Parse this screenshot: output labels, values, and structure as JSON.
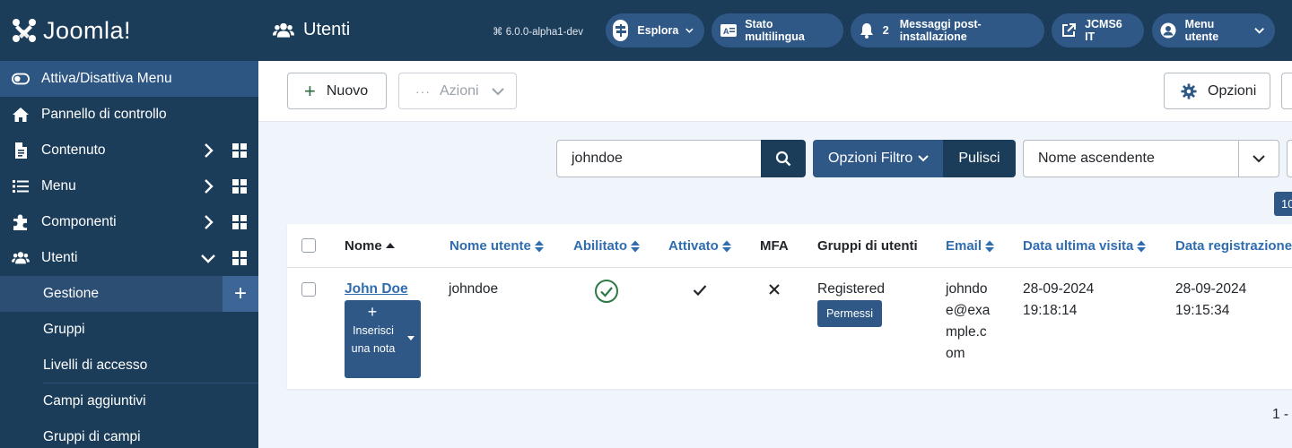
{
  "brand": {
    "name": "Joomla!"
  },
  "sidebar": {
    "toggle_label": "Attiva/Disattiva Menu",
    "items": [
      {
        "label": "Pannello di controllo",
        "icon": "home-icon"
      },
      {
        "label": "Contenuto",
        "icon": "file-icon"
      },
      {
        "label": "Menu",
        "icon": "list-icon"
      },
      {
        "label": "Componenti",
        "icon": "puzzle-icon"
      },
      {
        "label": "Utenti",
        "icon": "users-icon"
      }
    ],
    "sub_items": [
      {
        "label": "Gestione"
      },
      {
        "label": "Gruppi"
      },
      {
        "label": "Livelli di accesso"
      },
      {
        "label": "Campi aggiuntivi"
      },
      {
        "label": "Gruppi di campi"
      }
    ]
  },
  "header": {
    "title": "Utenti",
    "version": "6.0.0-alpha1-dev",
    "buttons": {
      "explore": "Esplora",
      "multilang": "Stato multilingua",
      "messages_count": "2",
      "messages": "Messaggi post-installazione",
      "site": "JCMS6 IT",
      "user_menu": "Menu utente"
    }
  },
  "toolbar": {
    "new_label": "Nuovo",
    "actions_label": "Azioni",
    "options_label": "Opzioni"
  },
  "filters": {
    "search_value": "johndoe",
    "filter_options_label": "Opzioni Filtro",
    "clear_label": "Pulisci",
    "sort_value": "Nome ascendente",
    "limit_value": "10"
  },
  "table": {
    "columns": {
      "name": "Nome",
      "username": "Nome utente",
      "enabled": "Abilitato",
      "activated": "Attivato",
      "mfa": "MFA",
      "groups": "Gruppi di utenti",
      "email": "Email",
      "last_visit": "Data ultima visita",
      "registered": "Data registrazione"
    },
    "rows": [
      {
        "name": "John Doe",
        "note_button": "Inserisci una nota",
        "username": "johndoe",
        "groups": "Registered",
        "permissions": "Permessi",
        "email_lines": [
          "johndo",
          "e@exa",
          "mple.c",
          "om"
        ],
        "last_visit_date": "28-09-2024",
        "last_visit_time": "19:18:14",
        "registered_date": "28-09-2024",
        "registered_time": "19:15:34"
      }
    ]
  },
  "pagination": {
    "text": "1 -"
  }
}
